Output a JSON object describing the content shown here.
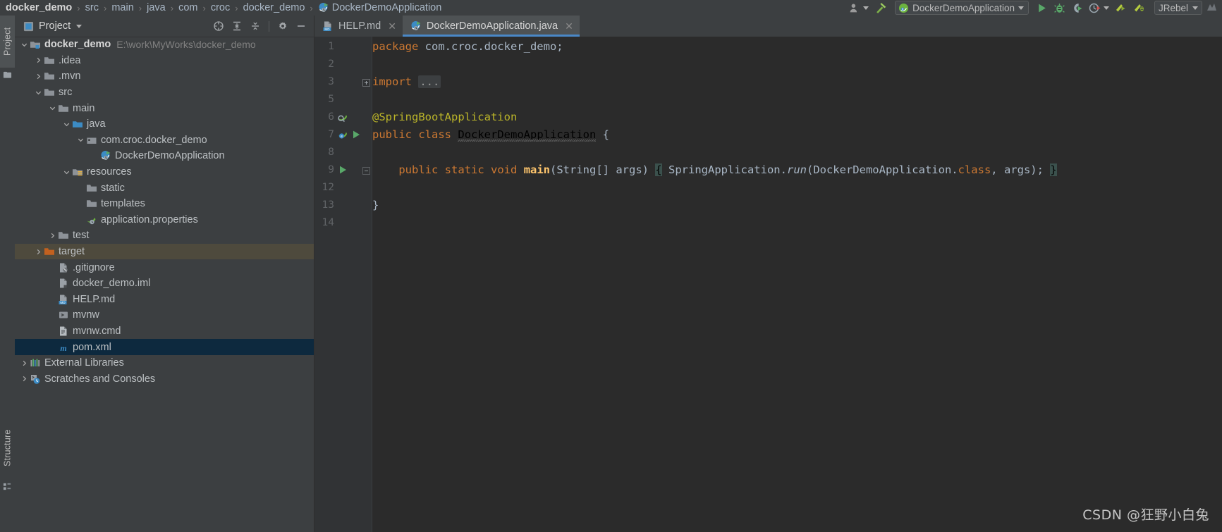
{
  "breadcrumb": {
    "items": [
      {
        "label": "docker_demo",
        "bold": true,
        "icon": "none"
      },
      {
        "label": "src",
        "bold": false,
        "icon": "none"
      },
      {
        "label": "main",
        "bold": false,
        "icon": "none"
      },
      {
        "label": "java",
        "bold": false,
        "icon": "none"
      },
      {
        "label": "com",
        "bold": false,
        "icon": "none"
      },
      {
        "label": "croc",
        "bold": false,
        "icon": "none"
      },
      {
        "label": "docker_demo",
        "bold": false,
        "icon": "none"
      },
      {
        "label": "DockerDemoApplication",
        "bold": false,
        "icon": "spring-class-icon"
      }
    ],
    "separator": "›"
  },
  "toolbar": {
    "profiles_icon": "user-profile-icon",
    "build_icon": "hammer-icon",
    "run_config": {
      "label": "DockerDemoApplication",
      "icon": "spring-boot-icon",
      "dropdown_icon": "chevron-down-icon"
    },
    "run_icon": "run-icon",
    "debug_icon": "debug-icon",
    "run_coverage_icon": "run-with-coverage-icon",
    "profiler_icon": "profiler-icon",
    "profiler_dropdown_icon": "chevron-down-icon",
    "jrebel_run_icon": "jrebel-run-icon",
    "jrebel_debug_icon": "jrebel-debug-icon",
    "jrebel": {
      "label": "JRebel",
      "dropdown_icon": "chevron-down-icon"
    },
    "search_icon": "search-everywhere-icon"
  },
  "left_tool_strip": {
    "tabs": [
      {
        "label": "Project",
        "icon": "project-icon",
        "selected": true
      },
      {
        "label": "Structure",
        "icon": "structure-icon",
        "selected": false
      }
    ]
  },
  "project_panel": {
    "title": "Project",
    "title_icon": "project-view-icon",
    "title_dropdown_icon": "chevron-down-icon",
    "actions": [
      {
        "name": "select-opened-file-icon",
        "label": "Select Opened File"
      },
      {
        "name": "expand-all-icon",
        "label": "Expand All"
      },
      {
        "name": "collapse-all-icon",
        "label": "Collapse All"
      },
      {
        "name": "settings-gear-icon",
        "label": "Settings"
      },
      {
        "name": "hide-icon",
        "label": "Hide"
      }
    ],
    "tree": [
      {
        "label": "docker_demo",
        "path": "E:\\work\\MyWorks\\docker_demo",
        "depth": 0,
        "arrow": "down",
        "icon": "module-icon",
        "bold": true,
        "state": "none"
      },
      {
        "label": ".idea",
        "path": "",
        "depth": 1,
        "arrow": "right",
        "icon": "folder-icon",
        "bold": false,
        "state": "none"
      },
      {
        "label": ".mvn",
        "path": "",
        "depth": 1,
        "arrow": "right",
        "icon": "folder-icon",
        "bold": false,
        "state": "none"
      },
      {
        "label": "src",
        "path": "",
        "depth": 1,
        "arrow": "down",
        "icon": "folder-icon",
        "bold": false,
        "state": "none"
      },
      {
        "label": "main",
        "path": "",
        "depth": 2,
        "arrow": "down",
        "icon": "folder-icon",
        "bold": false,
        "state": "none"
      },
      {
        "label": "java",
        "path": "",
        "depth": 3,
        "arrow": "down",
        "icon": "source-root-icon",
        "bold": false,
        "state": "none"
      },
      {
        "label": "com.croc.docker_demo",
        "path": "",
        "depth": 4,
        "arrow": "down",
        "icon": "package-icon",
        "bold": false,
        "state": "none"
      },
      {
        "label": "DockerDemoApplication",
        "path": "",
        "depth": 5,
        "arrow": "none",
        "icon": "spring-class-icon",
        "bold": false,
        "state": "none"
      },
      {
        "label": "resources",
        "path": "",
        "depth": 3,
        "arrow": "down",
        "icon": "resource-root-icon",
        "bold": false,
        "state": "none"
      },
      {
        "label": "static",
        "path": "",
        "depth": 4,
        "arrow": "none",
        "icon": "folder-icon",
        "bold": false,
        "state": "none"
      },
      {
        "label": "templates",
        "path": "",
        "depth": 4,
        "arrow": "none",
        "icon": "folder-icon",
        "bold": false,
        "state": "none"
      },
      {
        "label": "application.properties",
        "path": "",
        "depth": 4,
        "arrow": "none",
        "icon": "spring-properties-icon",
        "bold": false,
        "state": "none"
      },
      {
        "label": "test",
        "path": "",
        "depth": 2,
        "arrow": "right",
        "icon": "folder-icon",
        "bold": false,
        "state": "none"
      },
      {
        "label": "target",
        "path": "",
        "depth": 1,
        "arrow": "right",
        "icon": "excluded-folder-icon",
        "bold": false,
        "state": "highlight"
      },
      {
        "label": ".gitignore",
        "path": "",
        "depth": 2,
        "arrow": "none",
        "icon": "gitignore-file-icon",
        "bold": false,
        "state": "none"
      },
      {
        "label": "docker_demo.iml",
        "path": "",
        "depth": 2,
        "arrow": "none",
        "icon": "iml-file-icon",
        "bold": false,
        "state": "none"
      },
      {
        "label": "HELP.md",
        "path": "",
        "depth": 2,
        "arrow": "none",
        "icon": "markdown-file-icon",
        "bold": false,
        "state": "none"
      },
      {
        "label": "mvnw",
        "path": "",
        "depth": 2,
        "arrow": "none",
        "icon": "shell-script-icon",
        "bold": false,
        "state": "none"
      },
      {
        "label": "mvnw.cmd",
        "path": "",
        "depth": 2,
        "arrow": "none",
        "icon": "cmd-file-icon",
        "bold": false,
        "state": "none"
      },
      {
        "label": "pom.xml",
        "path": "",
        "depth": 2,
        "arrow": "none",
        "icon": "maven-file-icon",
        "bold": false,
        "state": "selected"
      },
      {
        "label": "External Libraries",
        "path": "",
        "depth": 0,
        "arrow": "right",
        "icon": "libraries-icon",
        "bold": false,
        "state": "none"
      },
      {
        "label": "Scratches and Consoles",
        "path": "",
        "depth": 0,
        "arrow": "right",
        "icon": "scratches-icon",
        "bold": false,
        "state": "none"
      }
    ]
  },
  "editor": {
    "tabs": [
      {
        "label": "HELP.md",
        "icon": "markdown-file-icon",
        "active": false,
        "close_icon": "close-icon"
      },
      {
        "label": "DockerDemoApplication.java",
        "icon": "spring-class-icon",
        "active": true,
        "close_icon": "close-icon"
      }
    ],
    "lines": [
      {
        "num": "1",
        "gutter_icons": [],
        "fold": "none",
        "segments": [
          {
            "t": "package",
            "c": "kw"
          },
          {
            "t": " com.croc.docker_demo;",
            "c": "pl"
          }
        ]
      },
      {
        "num": "2",
        "gutter_icons": [],
        "fold": "none",
        "segments": []
      },
      {
        "num": "3",
        "gutter_icons": [],
        "fold": "plus",
        "segments": [
          {
            "t": "import",
            "c": "kw"
          },
          {
            "t": " ",
            "c": "pl"
          },
          {
            "t": "...",
            "c": "fold-ph"
          }
        ]
      },
      {
        "num": "5",
        "gutter_icons": [],
        "fold": "none",
        "segments": []
      },
      {
        "num": "6",
        "gutter_icons": [
          "spring-bean-icon"
        ],
        "fold": "none",
        "segments": [
          {
            "t": "@SpringBootApplication",
            "c": "ann"
          }
        ]
      },
      {
        "num": "7",
        "gutter_icons": [
          "spring-config-icon",
          "run-icon"
        ],
        "fold": "none",
        "segments": [
          {
            "t": "public",
            "c": "kw"
          },
          {
            "t": " ",
            "c": "pl"
          },
          {
            "t": "class",
            "c": "kw"
          },
          {
            "t": " ",
            "c": "pl"
          },
          {
            "t": "DockerDemoApplication",
            "c": "squiggle"
          },
          {
            "t": " {",
            "c": "pl"
          }
        ]
      },
      {
        "num": "8",
        "gutter_icons": [],
        "fold": "none",
        "segments": []
      },
      {
        "num": "9",
        "gutter_icons": [
          "run-icon"
        ],
        "fold": "box",
        "segments": [
          {
            "t": "    ",
            "c": "pl"
          },
          {
            "t": "public",
            "c": "kw"
          },
          {
            "t": " ",
            "c": "pl"
          },
          {
            "t": "static",
            "c": "kw"
          },
          {
            "t": " ",
            "c": "pl"
          },
          {
            "t": "void",
            "c": "kw"
          },
          {
            "t": " ",
            "c": "pl"
          },
          {
            "t": "main",
            "c": "mname"
          },
          {
            "t": "(String[] args) ",
            "c": "pl"
          },
          {
            "t": "{",
            "c": "brace-hl"
          },
          {
            "t": " SpringApplication.",
            "c": "pl"
          },
          {
            "t": "run",
            "c": "ital"
          },
          {
            "t": "(DockerDemoApplication.",
            "c": "pl"
          },
          {
            "t": "class",
            "c": "kw"
          },
          {
            "t": ", args); ",
            "c": "pl"
          },
          {
            "t": "}",
            "c": "brace-hl"
          }
        ]
      },
      {
        "num": "12",
        "gutter_icons": [],
        "fold": "none",
        "segments": []
      },
      {
        "num": "13",
        "gutter_icons": [],
        "fold": "none",
        "segments": [
          {
            "t": "}",
            "c": "pl"
          }
        ]
      },
      {
        "num": "14",
        "gutter_icons": [],
        "fold": "none",
        "segments": []
      }
    ]
  },
  "watermark": "CSDN @狂野小白兔",
  "colors": {
    "panel_bg": "#3c3f41",
    "editor_bg": "#2b2b2b",
    "gutter_bg": "#313335",
    "accent_blue": "#4a88c7",
    "selection_blue": "#0d293e",
    "highlight_khaki": "#4e4a3d",
    "text": "#b5b9bc",
    "keyword_orange": "#cc7832",
    "annotation_yellow": "#bbb529",
    "method_gold": "#ffc66d"
  }
}
